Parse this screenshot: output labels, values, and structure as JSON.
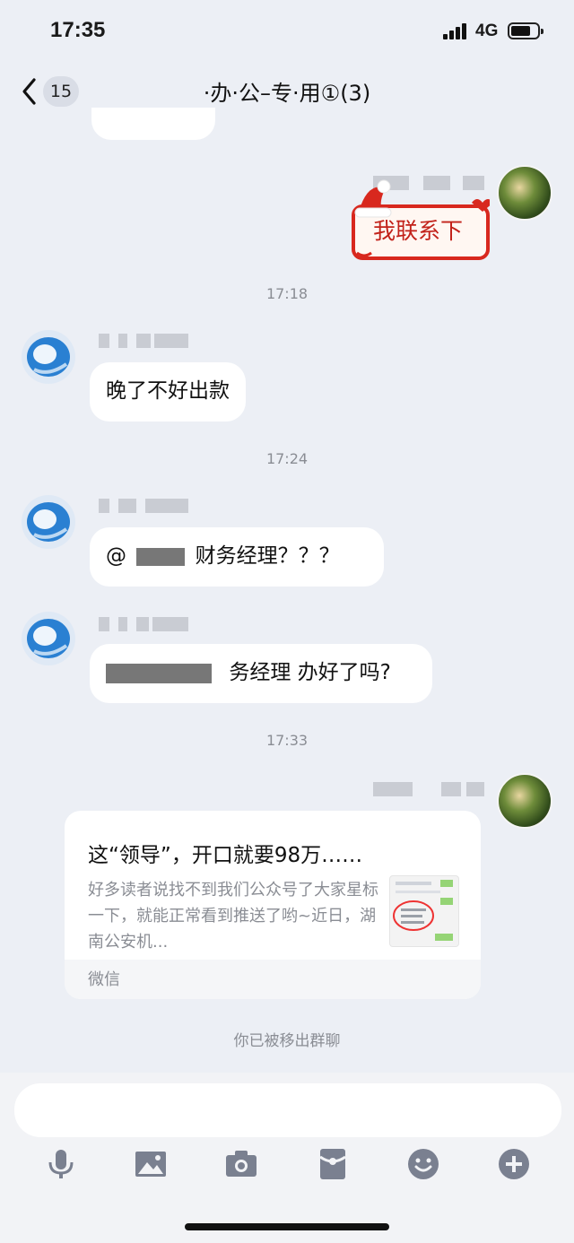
{
  "status_bar": {
    "time": "17:35",
    "network": "4G",
    "battery_level": 0.75
  },
  "nav": {
    "unread_count": "15",
    "title": "·办·公–专·用①(3)"
  },
  "messages": [
    {
      "type": "sticker",
      "text": "我联系下"
    },
    {
      "type": "timestamp",
      "text": "17:18"
    },
    {
      "type": "text",
      "text": "晚了不好出款"
    },
    {
      "type": "timestamp",
      "text": "17:24"
    },
    {
      "type": "text",
      "text_prefix": "@",
      "text": "财务经理？？？"
    },
    {
      "type": "text",
      "text": "务经理 办好了吗?"
    },
    {
      "type": "timestamp",
      "text": "17:33"
    },
    {
      "type": "link_card",
      "title": "这“领导”，开口就要98万……",
      "description": "好多读者说找不到我们公众号了大家星标一下，就能正常看到推送了哟~近日，湖南公安机...",
      "source": "微信"
    }
  ],
  "system_notice": "你已被移出群聊",
  "colors": {
    "background": "#eceff5",
    "bubble": "#ffffff",
    "sticker_red": "#d8281e",
    "meta_gray": "#8a8d94"
  },
  "toolbar_icons": [
    "microphone-icon",
    "image-icon",
    "camera-icon",
    "red-packet-icon",
    "emoji-icon",
    "plus-icon"
  ]
}
